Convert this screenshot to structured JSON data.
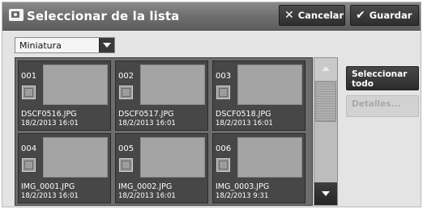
{
  "title": "Seleccionar de la lista",
  "toolbar": {
    "cancel_label": "Cancelar",
    "cancel_icon": "close-icon",
    "save_label": "Guardar",
    "save_icon": "checkmark-icon"
  },
  "view_select": {
    "value": "Miniatura"
  },
  "files": [
    {
      "number": "001",
      "name": "DSCF0516.JPG",
      "date": "18/2/2013 16:01",
      "checked": false
    },
    {
      "number": "002",
      "name": "DSCF0517.JPG",
      "date": "18/2/2013 16:01",
      "checked": false
    },
    {
      "number": "003",
      "name": "DSCF0518.JPG",
      "date": "18/2/2013 16:01",
      "checked": false
    },
    {
      "number": "004",
      "name": "IMG_0001.JPG",
      "date": "18/2/2013 16:01",
      "checked": false
    },
    {
      "number": "005",
      "name": "IMG_0002.JPG",
      "date": "18/2/2013 16:01",
      "checked": false
    },
    {
      "number": "006",
      "name": "IMG_0003.JPG",
      "date": "18/2/2013 9:31",
      "checked": false
    }
  ],
  "side": {
    "select_all_label": "Seleccionar todo",
    "details_label": "Detalles..."
  }
}
